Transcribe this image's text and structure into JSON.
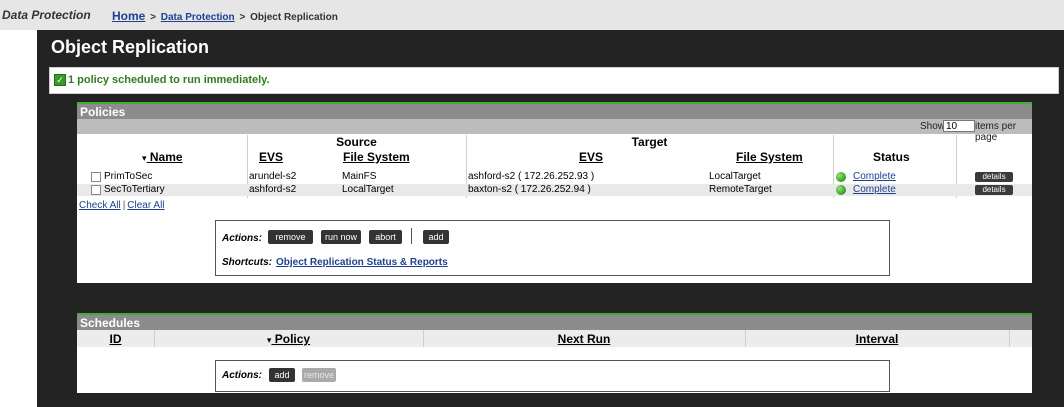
{
  "topbar": {
    "app_title": "Data Protection",
    "breadcrumb": {
      "home": "Home",
      "sep1": ">",
      "link": "Data Protection",
      "sep2": ">",
      "current": "Object Replication"
    }
  },
  "page": {
    "title": "Object Replication",
    "message": "1 policy scheduled to run immediately."
  },
  "policies": {
    "title": "Policies",
    "show_label": "Show",
    "show_value": "10",
    "items_per_page": "items per page",
    "group_source": "Source",
    "group_target": "Target",
    "columns": {
      "name": "Name",
      "source_evs": "EVS",
      "source_fs": "File System",
      "target_evs": "EVS",
      "target_fs": "File System",
      "status": "Status"
    },
    "sort_indicator": "▾",
    "rows": [
      {
        "name": "PrimToSec",
        "source_evs": "arundel-s2",
        "source_fs": "MainFS",
        "target_evs": "ashford-s2 ( 172.26.252.93 )",
        "target_fs": "LocalTarget",
        "status": "Complete",
        "details": "details"
      },
      {
        "name": "SecToTertiary",
        "source_evs": "ashford-s2",
        "source_fs": "LocalTarget",
        "target_evs": "baxton-s2 ( 172.26.252.94 )",
        "target_fs": "RemoteTarget",
        "status": "Complete",
        "details": "details"
      }
    ],
    "check_all": "Check All",
    "clear_all": "Clear All",
    "separator": "|",
    "actions_label": "Actions:",
    "buttons": {
      "remove": "remove",
      "run_now": "run now",
      "abort": "abort",
      "add": "add"
    },
    "shortcuts_label": "Shortcuts:",
    "shortcut_link": "Object Replication Status & Reports"
  },
  "schedules": {
    "title": "Schedules",
    "columns": {
      "id": "ID",
      "policy": "Policy",
      "next_run": "Next Run",
      "interval": "Interval"
    },
    "sort_indicator": "▾",
    "actions_label": "Actions:",
    "buttons": {
      "add": "add",
      "remove": "remove"
    }
  },
  "colors": {
    "accent_green": "#3cb034",
    "link_blue": "#1f3f8f",
    "dark_bg": "#232323",
    "header_gray": "#8c8c8c"
  }
}
